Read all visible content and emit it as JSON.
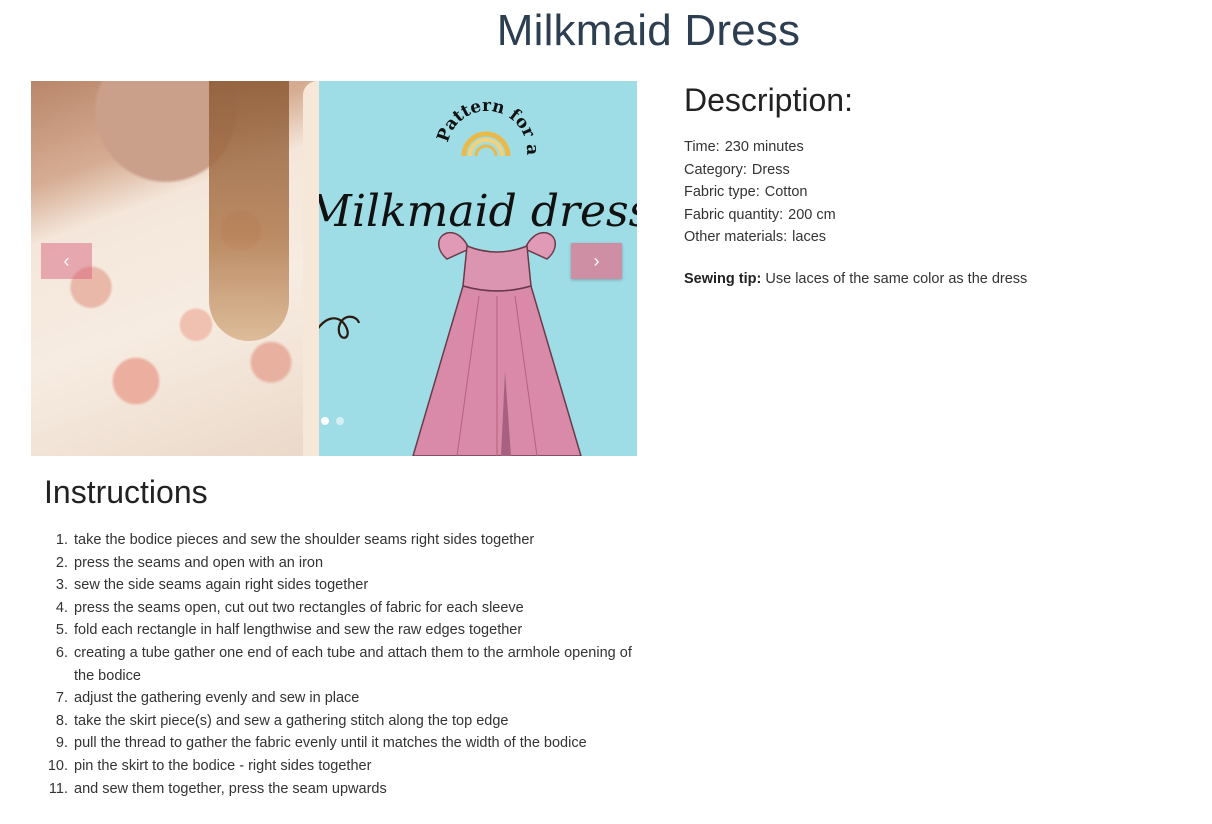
{
  "page": {
    "title": "Milkmaid Dress"
  },
  "carousel": {
    "art_script_top": "Pattern for all",
    "art_title": "Milkmaid dress",
    "prev_icon": "chevron-left-icon",
    "next_icon": "chevron-right-icon",
    "prev_glyph": "‹",
    "next_glyph": "›",
    "active_slide": 1,
    "slide_count": 2
  },
  "description": {
    "heading": "Description:",
    "rows": [
      {
        "label": "Time:",
        "value": "230 minutes"
      },
      {
        "label": "Category:",
        "value": "Dress"
      },
      {
        "label": "Fabric type:",
        "value": "Cotton"
      },
      {
        "label": "Fabric quantity:",
        "value": "200 cm"
      },
      {
        "label": "Other materials:",
        "value": "laces"
      }
    ],
    "tip_label": "Sewing tip:",
    "tip_text": "Use laces of the same color as the dress"
  },
  "instructions": {
    "heading": "Instructions",
    "steps": [
      {
        "n": "1.",
        "text": "take the bodice pieces and sew the shoulder seams right sides together"
      },
      {
        "n": "2.",
        "text": "press the seams and open with an iron"
      },
      {
        "n": "3.",
        "text": "sew the side seams again right sides together"
      },
      {
        "n": "4.",
        "text": "press the seams open, cut out two rectangles of fabric for each sleeve"
      },
      {
        "n": "5.",
        "text": "fold each rectangle in half lengthwise and sew the raw edges together"
      },
      {
        "n": "6.",
        "text": "creating a tube gather one end of each tube and attach them to the armhole opening of the bodice"
      },
      {
        "n": "7.",
        "text": "adjust the gathering evenly and sew in place"
      },
      {
        "n": "8.",
        "text": "take the skirt piece(s) and sew a gathering stitch along the top edge"
      },
      {
        "n": "9.",
        "text": "pull the thread to gather the fabric evenly until it matches the width of the bodice"
      },
      {
        "n": "10.",
        "text": "pin the skirt to the bodice - right sides together"
      },
      {
        "n": "11.",
        "text": "and sew them together, press the seam upwards"
      }
    ]
  },
  "colors": {
    "title": "#2c3e50",
    "art_background": "#9fdde6",
    "dress_pink": "#d98aa8",
    "nav_button": "#d68098"
  }
}
